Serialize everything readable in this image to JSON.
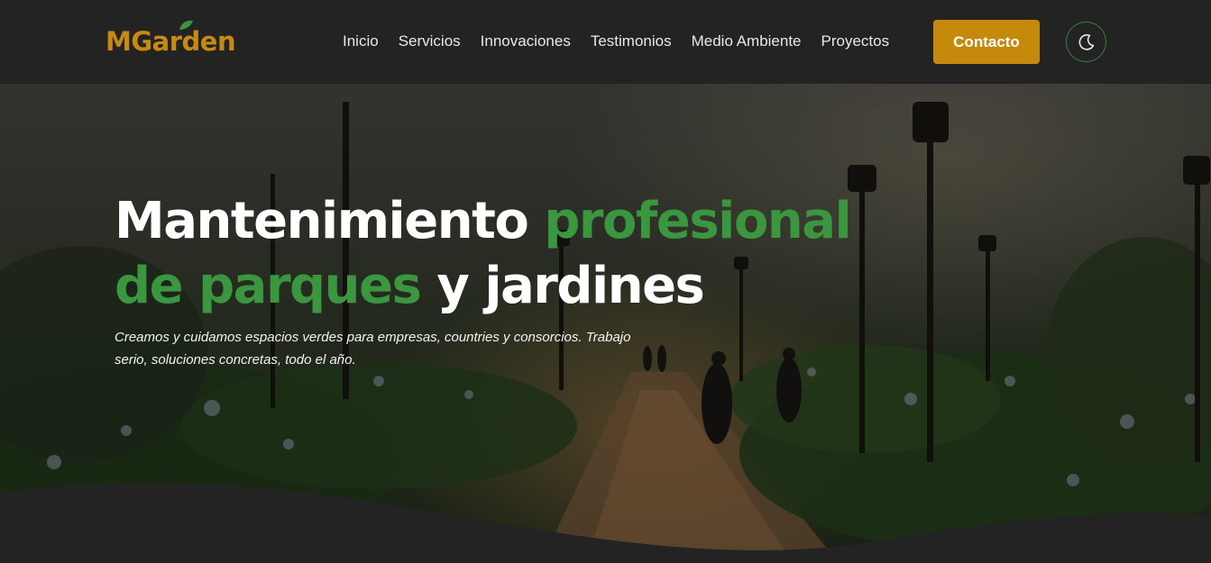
{
  "brand": {
    "name": "MGarden",
    "color": "#c58a13",
    "leaf_color": "#3a963f"
  },
  "nav": {
    "items": [
      {
        "label": "Inicio"
      },
      {
        "label": "Servicios"
      },
      {
        "label": "Innovaciones"
      },
      {
        "label": "Testimonios"
      },
      {
        "label": "Medio Ambiente"
      },
      {
        "label": "Proyectos"
      }
    ]
  },
  "header": {
    "contact_label": "Contacto",
    "theme_toggle_icon": "moon-icon"
  },
  "hero": {
    "headline_part1": "Mantenimiento ",
    "headline_highlight1": "profesional",
    "headline_highlight2": "de parques",
    "headline_part2": " y jardines",
    "subtitle": "Creamos y cuidamos espacios verdes para empresas, countries y consorcios. Trabajo serio, soluciones concretas, todo el año."
  },
  "colors": {
    "accent_green": "#3a963f",
    "accent_gold": "#c58a0b",
    "background": "#232323"
  }
}
